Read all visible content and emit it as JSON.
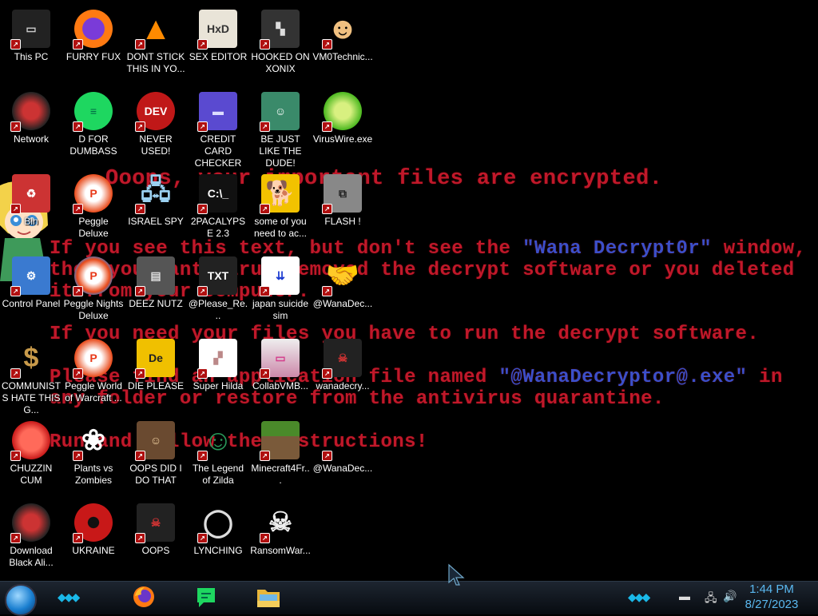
{
  "wallpaper": {
    "line1": "Ooops, your important files are encrypted.",
    "line2a": "If you see this text, but don't see the ",
    "line2b": "\"Wana Decrypt0r\"",
    "line2c": " window,",
    "line3": "then your antivirus removed the decrypt software or you deleted",
    "line4": "it from your computer.",
    "line5": "If you need your files you have to run the decrypt software.",
    "line6a": "Please find an application file named ",
    "line6b": "\"@WanaDecryptor@.exe\"",
    "line6c": " in",
    "line7": "any folder or restore from the antivirus quarantine.",
    "line8": "Run and follow the instructions!"
  },
  "icons": [
    {
      "label": "This PC",
      "icon": "computer-icon"
    },
    {
      "label": "FURRY FUX",
      "icon": "firefox-icon"
    },
    {
      "label": "DONT STICK THIS IN YO...",
      "icon": "vlc-cone-icon"
    },
    {
      "label": "SEX EDITOR",
      "icon": "hxd-editor-icon"
    },
    {
      "label": "HOOKED ON XONIX",
      "icon": "xonix-game-icon"
    },
    {
      "label": "VM0Technic...",
      "icon": "doctor-icon"
    },
    {
      "label": "Network",
      "icon": "alien-skull-icon"
    },
    {
      "label": "D FOR DUMBASS",
      "icon": "speech-bubble-icon"
    },
    {
      "label": "NEVER USED!",
      "icon": "dev-cpp-icon"
    },
    {
      "label": "CREDIT CARD CHECKER",
      "icon": "credit-card-icon"
    },
    {
      "label": "BE JUST LIKE THE DUDE!",
      "icon": "santa-elf-icon"
    },
    {
      "label": "VirusWire.exe",
      "icon": "lime-icon"
    },
    {
      "label": "Bin",
      "icon": "recycle-bin-icon"
    },
    {
      "label": "Peggle Deluxe",
      "icon": "peggle-icon"
    },
    {
      "label": "ISRAEL SPY",
      "icon": "network-computers-icon"
    },
    {
      "label": "2PACALYPSE 2.3",
      "icon": "terminal-icon"
    },
    {
      "label": "some of you need to ac...",
      "icon": "brown-dog-icon"
    },
    {
      "label": "FLASH !",
      "icon": "flash-box-icon"
    },
    {
      "label": "Control Panel",
      "icon": "control-panel-icon"
    },
    {
      "label": "Peggle Nights Deluxe",
      "icon": "peggle-nights-icon"
    },
    {
      "label": "DEEZ NUTZ",
      "icon": "stacked-windows-icon"
    },
    {
      "label": "@Please_Re...",
      "icon": "text-file-icon"
    },
    {
      "label": "japan suicide sim",
      "icon": "document-icon"
    },
    {
      "label": "@WanaDec...",
      "icon": "handshake-icon"
    },
    {
      "label": "COMMUNISTS HATE THIS G...",
      "icon": "money-bag-icon"
    },
    {
      "label": "Peggle World of Warcraft ...",
      "icon": "peggle-wow-icon"
    },
    {
      "label": "DIE PLEASE",
      "icon": "de-yellow-icon"
    },
    {
      "label": "Super Hilda",
      "icon": "pixel-cat-icon"
    },
    {
      "label": "CollabVMB...",
      "icon": "monitor-pink-icon"
    },
    {
      "label": "wanadecry...",
      "icon": "alien-laptop-icon"
    },
    {
      "label": "CHUZZIN CUM",
      "icon": "chuzzle-icon"
    },
    {
      "label": "Plants vs Zombies",
      "icon": "flower-icon"
    },
    {
      "label": "OOPS DID I DO THAT",
      "icon": "portrait-icon"
    },
    {
      "label": "The Legend of Zilda",
      "icon": "zelda-icon"
    },
    {
      "label": "Minecraft4Fr...",
      "icon": "grass-block-icon"
    },
    {
      "label": "@WanaDec...",
      "icon": "wana-decryptor-icon"
    },
    {
      "label": "Download Black Ali...",
      "icon": "alien-skull-icon"
    },
    {
      "label": "UKRAINE",
      "icon": "radiation-icon"
    },
    {
      "label": "OOPS",
      "icon": "alien-laptop-icon"
    },
    {
      "label": "LYNCHING",
      "icon": "noose-icon"
    },
    {
      "label": "RansomWar...",
      "icon": "skull-ring-icon"
    }
  ],
  "taskbar": {
    "clock_time": "1:44 PM",
    "clock_date": "8/27/2023",
    "apps": [
      "firefox-icon",
      "speech-bubble-icon",
      "file-explorer-icon"
    ]
  }
}
